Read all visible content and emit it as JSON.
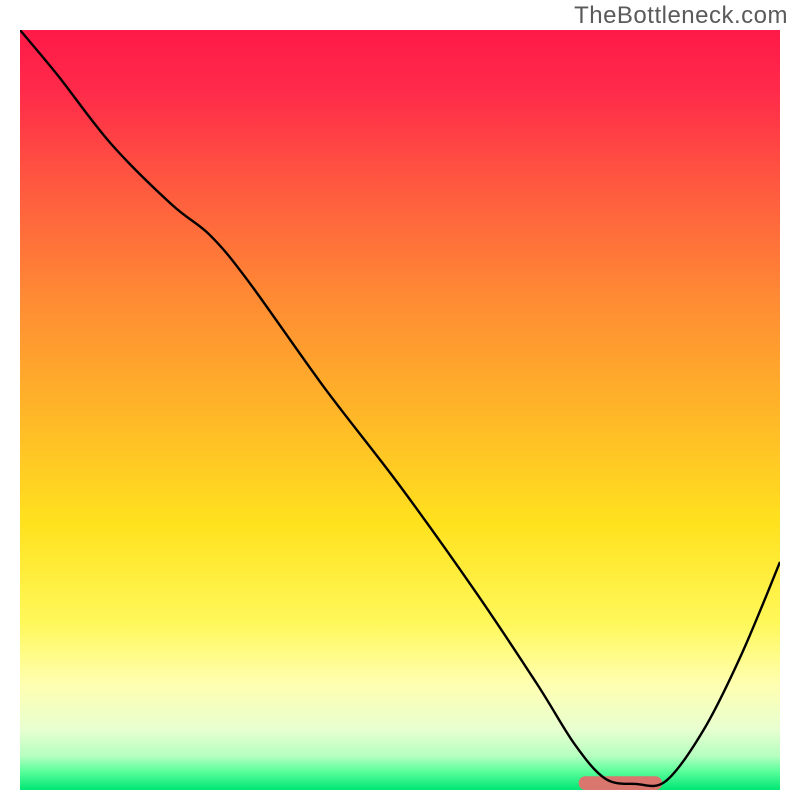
{
  "watermark": "TheBottleneck.com",
  "chart_data": {
    "type": "line",
    "title": "",
    "xlabel": "",
    "ylabel": "",
    "xlim": [
      0,
      100
    ],
    "ylim": [
      0,
      100
    ],
    "grid": false,
    "legend": false,
    "background_gradient_stops": [
      {
        "offset": 0.0,
        "color": "#ff1a48"
      },
      {
        "offset": 0.08,
        "color": "#ff2a4a"
      },
      {
        "offset": 0.2,
        "color": "#ff5740"
      },
      {
        "offset": 0.35,
        "color": "#ff8a34"
      },
      {
        "offset": 0.5,
        "color": "#ffb528"
      },
      {
        "offset": 0.65,
        "color": "#ffe21e"
      },
      {
        "offset": 0.78,
        "color": "#fff85a"
      },
      {
        "offset": 0.86,
        "color": "#ffffb0"
      },
      {
        "offset": 0.92,
        "color": "#e8ffd0"
      },
      {
        "offset": 0.955,
        "color": "#b6ffc0"
      },
      {
        "offset": 0.975,
        "color": "#5cff9c"
      },
      {
        "offset": 1.0,
        "color": "#00e673"
      }
    ],
    "series": [
      {
        "name": "bottleneck-curve",
        "color": "#000000",
        "stroke_width": 2.4,
        "x": [
          0,
          5,
          12,
          20,
          25,
          30,
          40,
          50,
          60,
          68,
          73,
          77,
          81,
          85,
          90,
          95,
          100
        ],
        "y": [
          100,
          94,
          85,
          77,
          73,
          67,
          53,
          40,
          26,
          14,
          6,
          1.5,
          0.8,
          1.2,
          8,
          18,
          30
        ]
      }
    ],
    "markers": [
      {
        "name": "target-zone-bar",
        "shape": "rounded-rect",
        "color": "#d9776f",
        "x_start": 73.5,
        "x_end": 84.5,
        "y": 0.9,
        "height_frac": 0.018
      }
    ]
  }
}
